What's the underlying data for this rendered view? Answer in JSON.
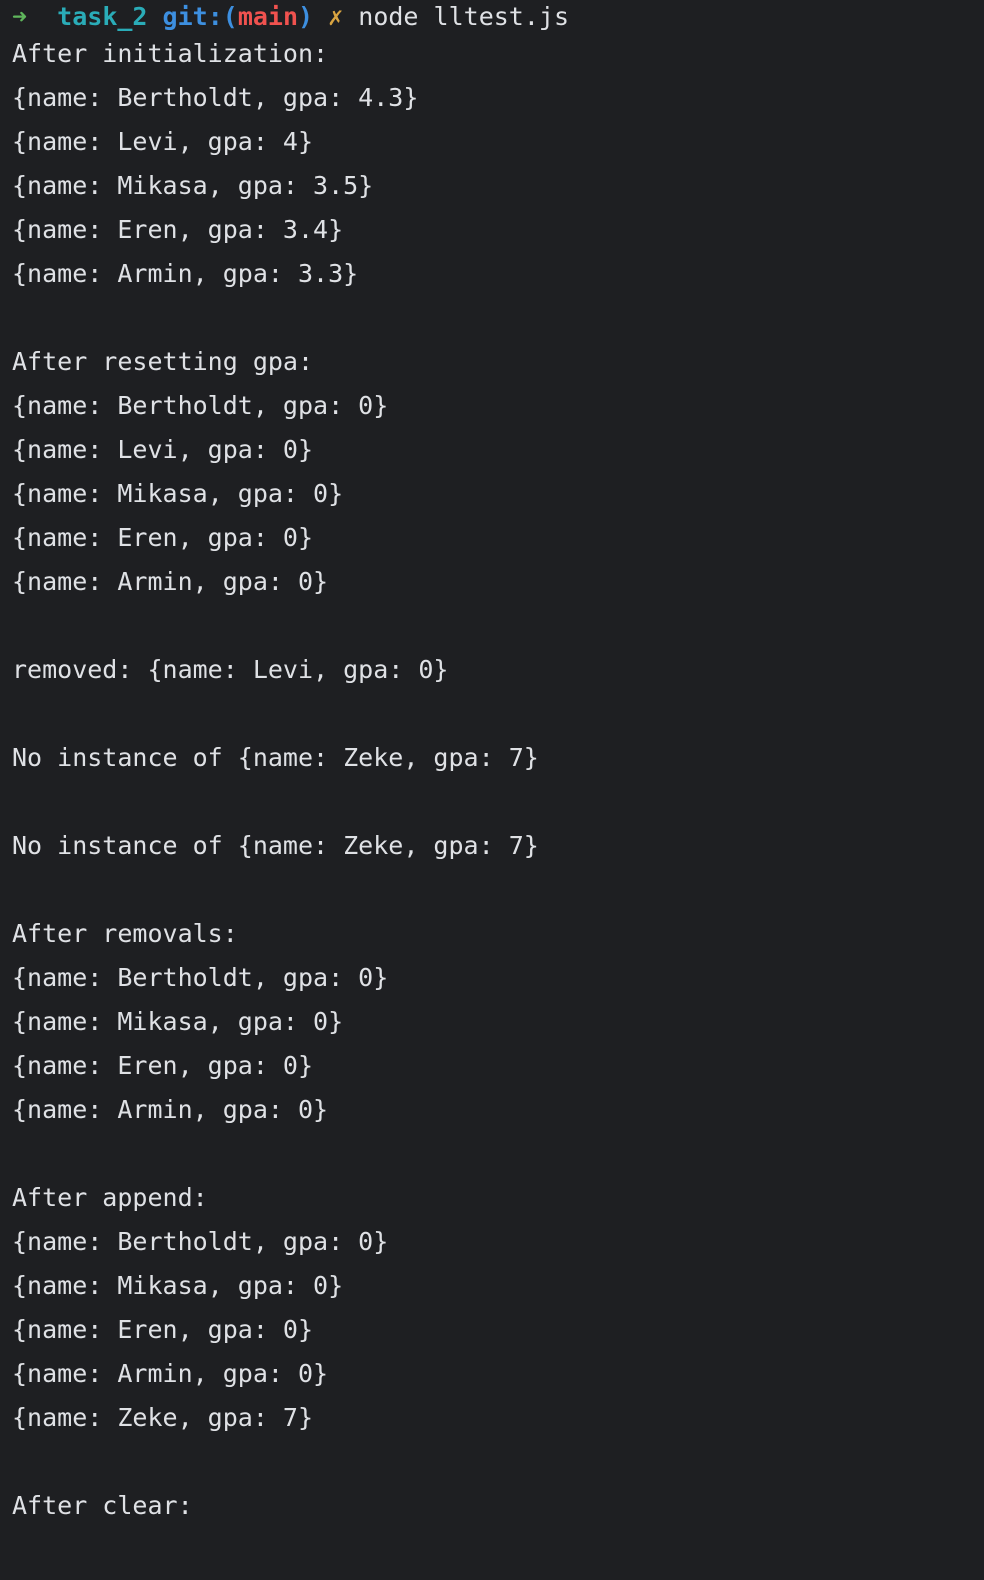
{
  "prompt": {
    "arrow": "➜",
    "directory": "task_2",
    "git_prefix": "git:(",
    "branch": "main",
    "git_suffix": ")",
    "dirty_marker": "✗",
    "command": "node lltest.js"
  },
  "output_lines": [
    "After initialization:",
    "{name: Bertholdt, gpa: 4.3}",
    "{name: Levi, gpa: 4}",
    "{name: Mikasa, gpa: 3.5}",
    "{name: Eren, gpa: 3.4}",
    "{name: Armin, gpa: 3.3}",
    "",
    "After resetting gpa:",
    "{name: Bertholdt, gpa: 0}",
    "{name: Levi, gpa: 0}",
    "{name: Mikasa, gpa: 0}",
    "{name: Eren, gpa: 0}",
    "{name: Armin, gpa: 0}",
    "",
    "removed: {name: Levi, gpa: 0}",
    "",
    "No instance of {name: Zeke, gpa: 7}",
    "",
    "No instance of {name: Zeke, gpa: 7}",
    "",
    "After removals:",
    "{name: Bertholdt, gpa: 0}",
    "{name: Mikasa, gpa: 0}",
    "{name: Eren, gpa: 0}",
    "{name: Armin, gpa: 0}",
    "",
    "After append:",
    "{name: Bertholdt, gpa: 0}",
    "{name: Mikasa, gpa: 0}",
    "{name: Eren, gpa: 0}",
    "{name: Armin, gpa: 0}",
    "{name: Zeke, gpa: 7}",
    "",
    "After clear:"
  ],
  "colors": {
    "background": "#1e1f22",
    "text": "#dfe1e5",
    "arrow": "#5fb65c",
    "directory": "#2aacb8",
    "git": "#3d8fe0",
    "branch": "#f0524f",
    "dirty_marker": "#d9a441"
  }
}
